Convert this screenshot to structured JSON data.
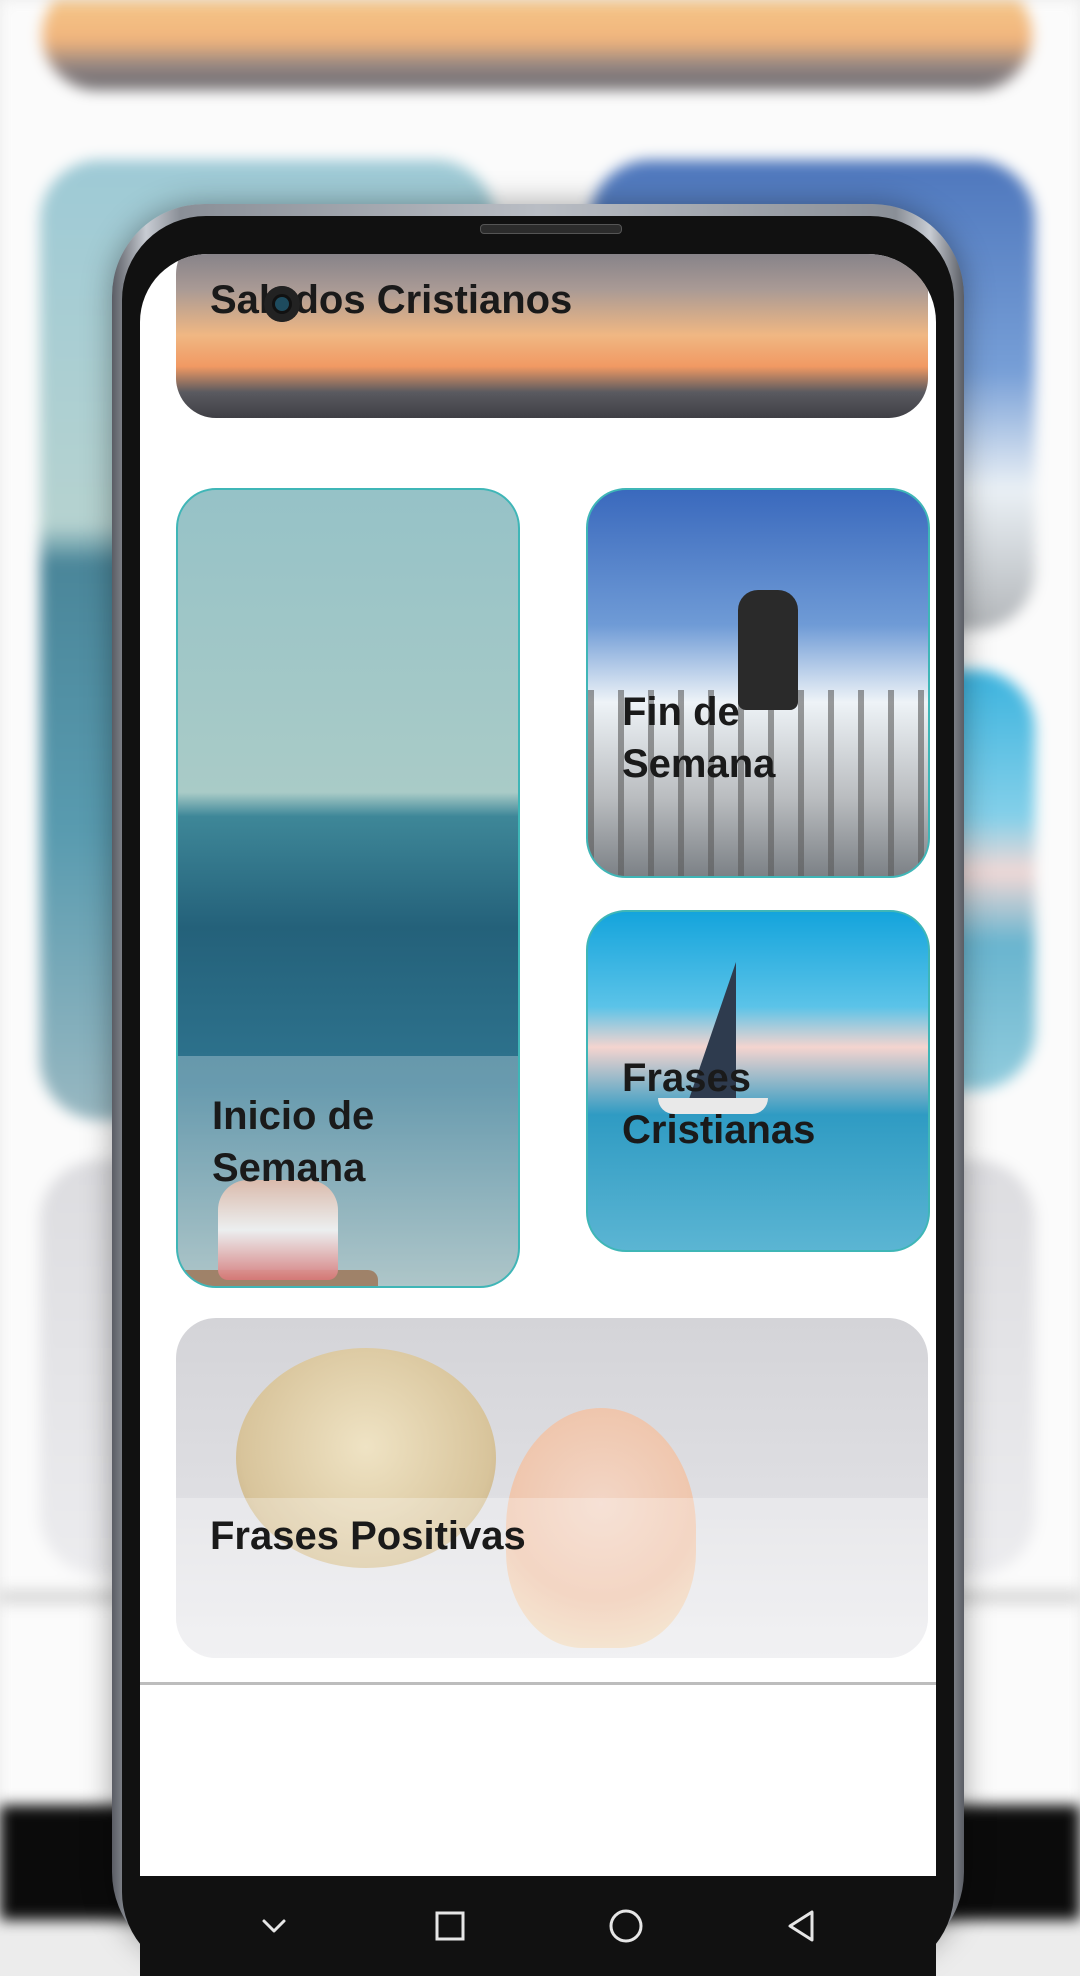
{
  "cards": {
    "saludos": {
      "label": "Saludos Cristianos"
    },
    "inicio": {
      "label": "Inicio de\nSemana"
    },
    "fin": {
      "label": "Fin de\nSemana"
    },
    "frases_cristianas": {
      "label": "Frases\nCristianas"
    },
    "frases_positivas": {
      "label": "Frases Positivas"
    }
  },
  "navbar": {
    "items": [
      {
        "name": "hide-keyboard",
        "icon": "chevron-down-icon"
      },
      {
        "name": "recents",
        "icon": "square-icon"
      },
      {
        "name": "home",
        "icon": "circle-icon"
      },
      {
        "name": "back",
        "icon": "triangle-back-icon"
      }
    ]
  },
  "colors": {
    "card_border": "#3fb6b7",
    "label": "#1a1a1a",
    "navbar_bg": "#111111",
    "screen_bg": "#ffffff"
  }
}
